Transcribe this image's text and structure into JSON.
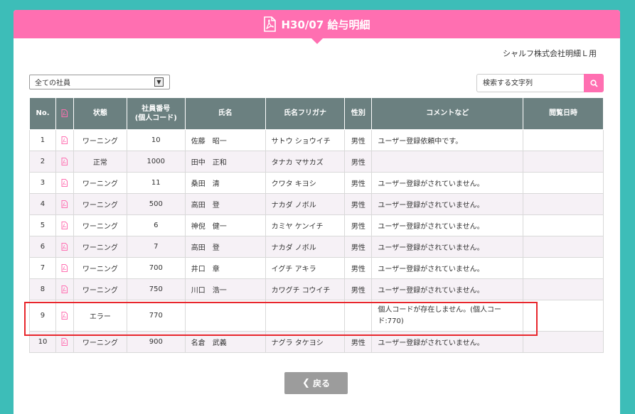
{
  "header": {
    "title": "H30/07 給与明細"
  },
  "company_label": "シャルフ株式会社明細Ｌ用",
  "filter": {
    "selected": "全ての社員"
  },
  "search": {
    "placeholder": "検索する文字列"
  },
  "table": {
    "columns": {
      "no": "No.",
      "status": "状態",
      "emp_no_line1": "社員番号",
      "emp_no_line2": "(個人コード)",
      "name": "氏名",
      "kana": "氏名フリガナ",
      "gender": "性別",
      "comment": "コメントなど",
      "viewed": "閲覧日時"
    },
    "rows": [
      {
        "no": "1",
        "status": "ワーニング",
        "emp": "10",
        "name": "佐藤　昭一",
        "kana": "サトウ ショウイチ",
        "gender": "男性",
        "comment": "ユーザー登録依頼中です。",
        "viewed": ""
      },
      {
        "no": "2",
        "status": "正常",
        "emp": "1000",
        "name": "田中　正和",
        "kana": "タナカ マサカズ",
        "gender": "男性",
        "comment": "",
        "viewed": ""
      },
      {
        "no": "3",
        "status": "ワーニング",
        "emp": "11",
        "name": "桑田　清",
        "kana": "クワタ キヨシ",
        "gender": "男性",
        "comment": "ユーザー登録がされていません。",
        "viewed": ""
      },
      {
        "no": "4",
        "status": "ワーニング",
        "emp": "500",
        "name": "高田　登",
        "kana": "ナカダ ノボル",
        "gender": "男性",
        "comment": "ユーザー登録がされていません。",
        "viewed": ""
      },
      {
        "no": "5",
        "status": "ワーニング",
        "emp": "6",
        "name": "神倪　健一",
        "kana": "カミヤ ケンイチ",
        "gender": "男性",
        "comment": "ユーザー登録がされていません。",
        "viewed": ""
      },
      {
        "no": "6",
        "status": "ワーニング",
        "emp": "7",
        "name": "高田　登",
        "kana": "ナカダ ノボル",
        "gender": "男性",
        "comment": "ユーザー登録がされていません。",
        "viewed": ""
      },
      {
        "no": "7",
        "status": "ワーニング",
        "emp": "700",
        "name": "井口　章",
        "kana": "イグチ アキラ",
        "gender": "男性",
        "comment": "ユーザー登録がされていません。",
        "viewed": ""
      },
      {
        "no": "8",
        "status": "ワーニング",
        "emp": "750",
        "name": "川口　浩一",
        "kana": "カワグチ コウイチ",
        "gender": "男性",
        "comment": "ユーザー登録がされていません。",
        "viewed": ""
      },
      {
        "no": "9",
        "status": "エラー",
        "emp": "770",
        "name": "",
        "kana": "",
        "gender": "",
        "comment": "個人コードが存在しません。(個人コード:770)",
        "viewed": ""
      },
      {
        "no": "10",
        "status": "ワーニング",
        "emp": "900",
        "name": "名倉　武義",
        "kana": "ナグラ タケヨシ",
        "gender": "男性",
        "comment": "ユーザー登録がされていません。",
        "viewed": ""
      }
    ]
  },
  "back_button": {
    "label": "戻る"
  },
  "colors": {
    "accent": "#ff6fb1",
    "background": "#3dbdb8",
    "table_header": "#6b8080",
    "highlight": "#e8262c",
    "button": "#9c9c9c"
  },
  "icons": {
    "pdf": "pdf-icon",
    "search": "search-icon",
    "back": "chevron-left-icon"
  }
}
